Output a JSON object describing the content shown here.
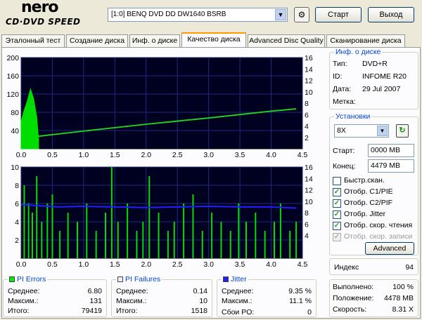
{
  "header": {
    "logo_top": "nero",
    "logo_bottom": "CD·DVD SPEED",
    "drive": "[1:0]  BENQ DVD DD DW1640 BSRB",
    "refresh_icon": "drive-refresh-icon",
    "start_label": "Старт",
    "exit_label": "Выход"
  },
  "tabs": [
    {
      "label": "Эталонный тест",
      "active": false
    },
    {
      "label": "Создание диска",
      "active": false
    },
    {
      "label": "Инф. о диске",
      "active": false
    },
    {
      "label": "Качество диска",
      "active": true
    },
    {
      "label": "Advanced Disc Quality",
      "active": false
    },
    {
      "label": "Сканирование диска",
      "active": false
    }
  ],
  "chart_data": [
    {
      "type": "line",
      "title": "",
      "x_ticks": [
        "0.0",
        "0.5",
        "1.0",
        "1.5",
        "2.0",
        "2.5",
        "3.0",
        "3.5",
        "4.0",
        "4.5"
      ],
      "y_left_ticks": [
        "200",
        "160",
        "120",
        "80",
        "40"
      ],
      "y_right_ticks": [
        "16",
        "14",
        "12",
        "10",
        "8",
        "6",
        "4",
        "2"
      ],
      "xlim": [
        0,
        4.5
      ],
      "ylim": [
        0,
        200
      ],
      "y2lim": [
        0,
        16
      ],
      "grid": true,
      "series": [
        {
          "type": "area",
          "color": "#00dd00",
          "x": [
            0.0,
            0.05,
            0.1,
            0.15,
            0.2,
            0.25,
            0.28
          ],
          "y": [
            60,
            85,
            105,
            131,
            110,
            70,
            20
          ]
        },
        {
          "type": "line",
          "axis": "right",
          "color": "#22cc22",
          "x": [
            0.28,
            1.0,
            2.0,
            3.0,
            4.0,
            4.4
          ],
          "y": [
            2.2,
            3.1,
            4.3,
            5.4,
            6.6,
            7.0
          ]
        }
      ]
    },
    {
      "type": "bar",
      "title": "",
      "x_ticks": [
        "0.0",
        "0.5",
        "1.0",
        "1.5",
        "2.0",
        "2.5",
        "3.0",
        "3.5",
        "4.0",
        "4.5"
      ],
      "y_left_ticks": [
        "10",
        "8",
        "6",
        "4",
        "2"
      ],
      "y_right_ticks": [
        "16",
        "14",
        "12",
        "10",
        "8",
        "6",
        "4"
      ],
      "xlim": [
        0,
        4.5
      ],
      "ylim": [
        0,
        10
      ],
      "y2lim": [
        0,
        16
      ],
      "grid": true,
      "series": [
        {
          "type": "bar",
          "color": "#00dd00",
          "x": [
            0.05,
            0.12,
            0.18,
            0.25,
            0.33,
            0.42,
            0.5,
            0.62,
            0.75,
            0.9,
            1.05,
            1.2,
            1.35,
            1.45,
            1.55,
            1.7,
            1.85,
            1.95,
            2.05,
            2.2,
            2.35,
            2.45,
            2.6,
            2.75,
            2.9,
            3.05,
            3.2,
            3.35,
            3.48,
            3.6,
            3.75,
            3.9,
            4.05,
            4.15,
            4.3,
            4.4
          ],
          "y": [
            8,
            6,
            5,
            9,
            4,
            6,
            7,
            3,
            5,
            4,
            6,
            3,
            5,
            10,
            4,
            6,
            3,
            4,
            9,
            5,
            3,
            4,
            6,
            7,
            3,
            5,
            4,
            3,
            6,
            4,
            5,
            3,
            4,
            6,
            3,
            4
          ]
        },
        {
          "type": "line",
          "axis": "right",
          "color": "#2020ff",
          "x": [
            0.0,
            0.3,
            0.6,
            1.0,
            1.5,
            2.0,
            2.5,
            3.0,
            3.5,
            4.0,
            4.4
          ],
          "y": [
            9.4,
            9.2,
            9.0,
            9.1,
            9.0,
            8.9,
            9.0,
            9.1,
            9.0,
            9.0,
            8.8
          ]
        }
      ]
    }
  ],
  "stats": {
    "pi_errors": {
      "title": "PI Errors",
      "color": "#00ee00",
      "avg_label": "Среднее:",
      "avg": "6.80",
      "max_label": "Максим.:",
      "max": "131",
      "total_label": "Итого:",
      "total": "79419"
    },
    "pi_failures": {
      "title": "PI Failures",
      "color": "#eeeeee",
      "avg_label": "Среднее:",
      "avg": "0.14",
      "max_label": "Максим.:",
      "max": "10",
      "total_label": "Итого:",
      "total": "1518"
    },
    "jitter": {
      "title": "Jitter",
      "color": "#2020ff",
      "avg_label": "Среднее:",
      "avg": "9.35 %",
      "max_label": "Максим.:",
      "max": "11.1 %",
      "po_label": "Сбои PO:",
      "po": "0"
    }
  },
  "disc_info": {
    "title": "Инф. о диске",
    "type_label": "Тип:",
    "type": "DVD+R",
    "id_label": "ID:",
    "id": "INFOME R20",
    "date_label": "Дата:",
    "date": "29 Jul 2007",
    "mark_label": "Метка:",
    "mark": ""
  },
  "settings": {
    "title": "Установки",
    "speed": "8X",
    "start_label": "Старт:",
    "start": "0000 MB",
    "end_label": "Конец:",
    "end": "4479 MB",
    "checks": [
      {
        "label": "Быстр.скан.",
        "checked": false,
        "enabled": true
      },
      {
        "label": "Отобр. C1/PIE",
        "checked": true,
        "enabled": true
      },
      {
        "label": "Отобр. C2/PIF",
        "checked": true,
        "enabled": true
      },
      {
        "label": "Отобр. Jitter",
        "checked": true,
        "enabled": true
      },
      {
        "label": "Отобр. скор. чтения",
        "checked": true,
        "enabled": true
      },
      {
        "label": "Отобр. скор. записи",
        "checked": true,
        "enabled": false
      }
    ],
    "advanced_label": "Advanced"
  },
  "index": {
    "label": "Индекс",
    "value": "94"
  },
  "progress": {
    "done_label": "Выполнено:",
    "done": "100 %",
    "pos_label": "Положение:",
    "pos": "4478 MB",
    "speed_label": "Скорость:",
    "speed": "8.31 X"
  }
}
